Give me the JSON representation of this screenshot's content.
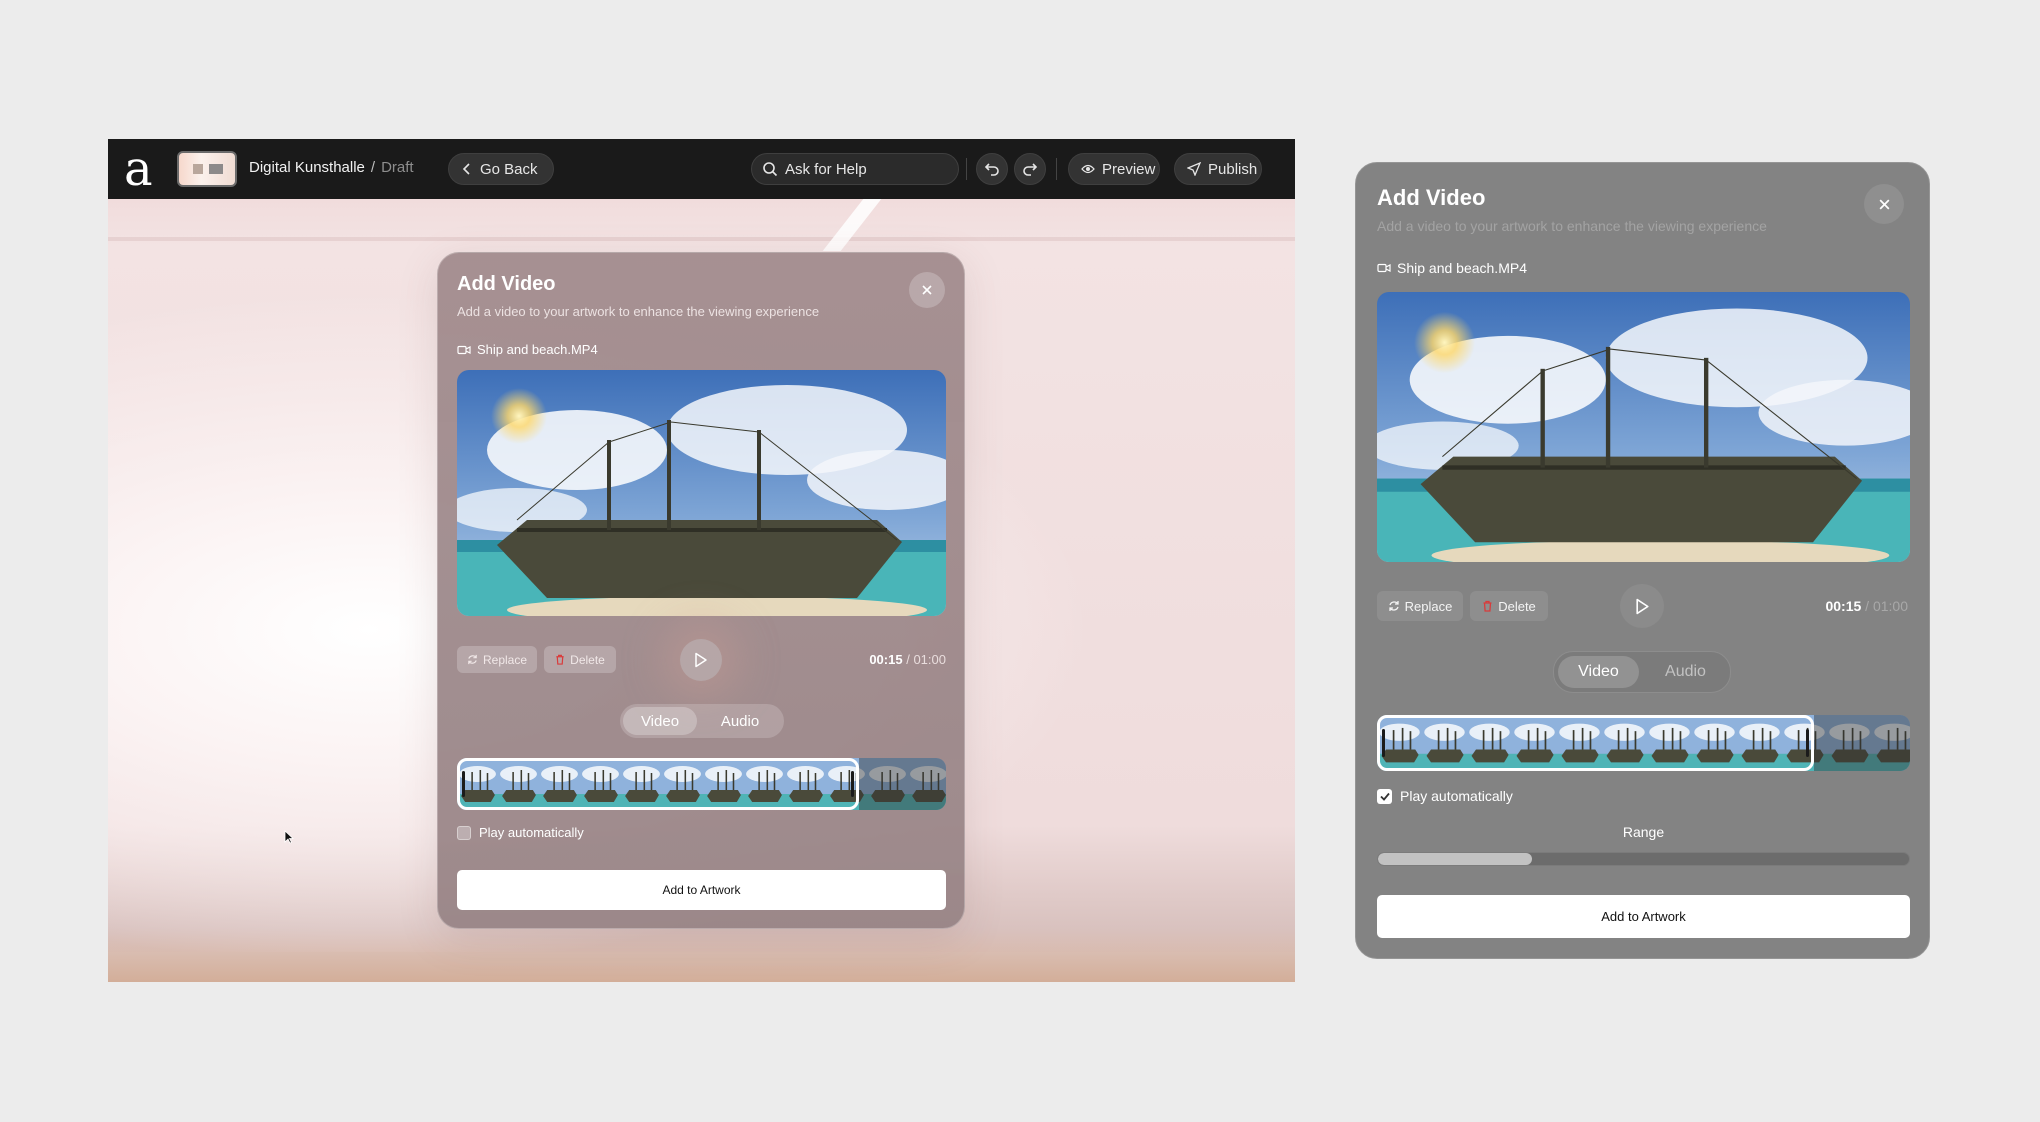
{
  "topbar": {
    "logo": "a",
    "project_name": "Digital Kunsthalle",
    "separator": "/",
    "status": "Draft",
    "go_back": "Go Back",
    "ask_help": "Ask for Help",
    "preview": "Preview",
    "publish": "Publish"
  },
  "modal": {
    "title": "Add Video",
    "subtitle": "Add a video to your artwork to enhance the viewing experience",
    "file_name": "Ship and beach.MP4",
    "replace": "Replace",
    "delete": "Delete",
    "time_current": "00:15",
    "time_sep": "/",
    "time_total": "01:00",
    "tabs": [
      "Video",
      "Audio"
    ],
    "active_tab": "Video",
    "play_auto_label": "Play automatically",
    "range_label": "Range",
    "add_button": "Add to Artwork"
  },
  "left_modal_state": {
    "play_automatically": false
  },
  "right_modal_state": {
    "play_automatically": true,
    "range_fraction": 0.29
  },
  "colors": {
    "topbar": "#1a1a1a",
    "page_bg": "#ececec",
    "modal_right_bg": "#838383",
    "accent_delete": "#d93b3b"
  },
  "icons": [
    "logo-a",
    "search-icon",
    "undo-icon",
    "redo-icon",
    "eye-icon",
    "send-icon",
    "chevron-left-icon",
    "video-file-icon",
    "refresh-icon",
    "trash-icon",
    "play-icon",
    "close-icon",
    "checkmark-icon",
    "cursor-icon"
  ]
}
